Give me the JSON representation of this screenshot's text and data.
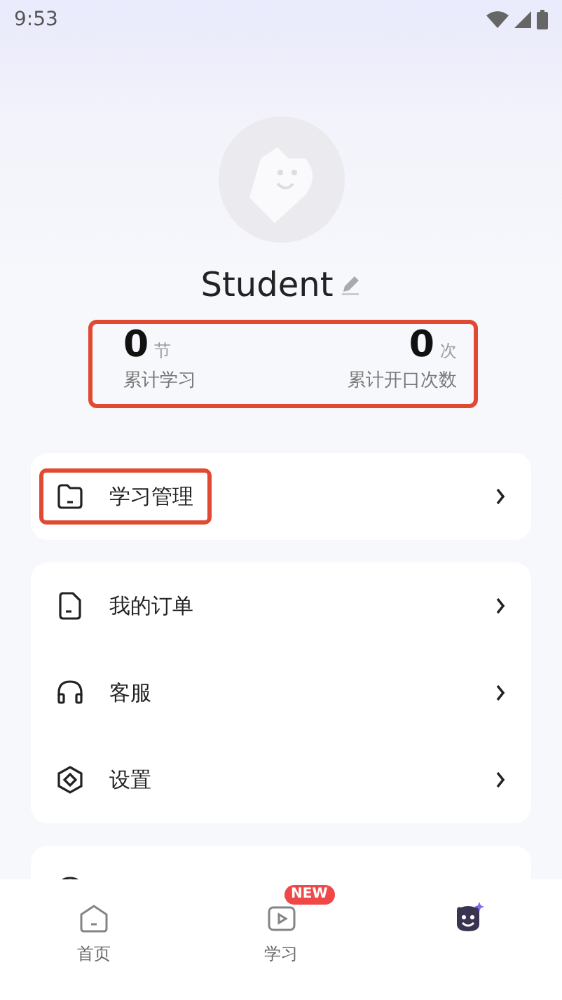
{
  "status_bar": {
    "time": "9:53"
  },
  "profile": {
    "name": "Student"
  },
  "stats": {
    "annotated": true,
    "items": [
      {
        "value": "0",
        "unit": "节",
        "label": "累计学习"
      },
      {
        "value": "0",
        "unit": "次",
        "label": "累计开口次数"
      }
    ]
  },
  "menu_groups": [
    {
      "items": [
        {
          "label": "学习管理",
          "annotated": true
        }
      ]
    },
    {
      "items": [
        {
          "label": "我的订单",
          "annotated": false
        },
        {
          "label": "客服",
          "annotated": false
        },
        {
          "label": "设置",
          "annotated": false
        }
      ]
    },
    {
      "items": [
        {
          "annotated": false
        }
      ]
    }
  ],
  "tab_bar": [
    {
      "label": "首页",
      "selected": false
    },
    {
      "label": "学习",
      "badge": "NEW",
      "selected": false
    },
    {
      "selected": true
    }
  ]
}
